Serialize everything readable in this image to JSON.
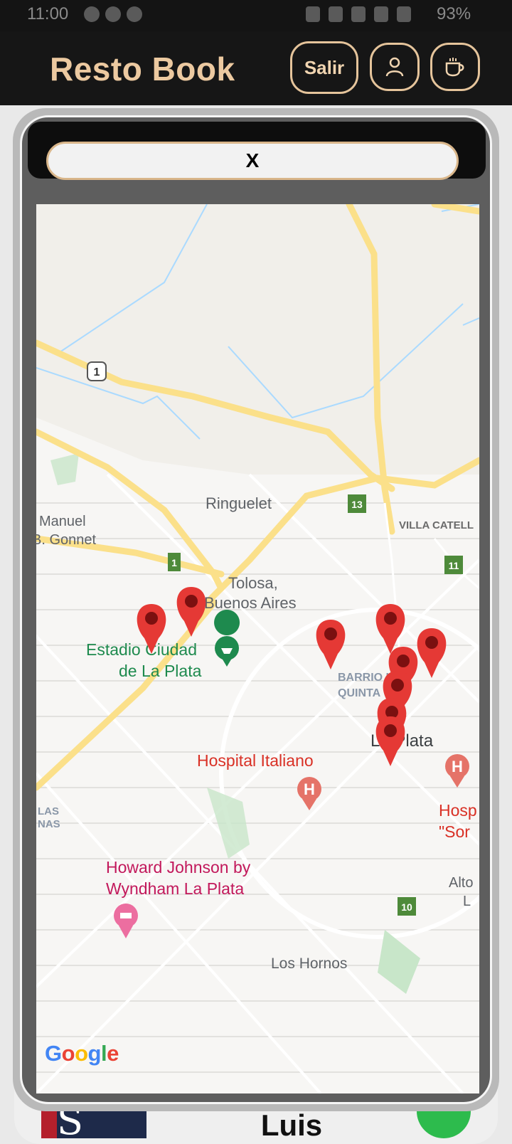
{
  "status_bar": {
    "time": "11:00",
    "battery": "93%"
  },
  "header": {
    "title": "Resto Book",
    "exit_label": "Salir"
  },
  "modal": {
    "close_label": "X"
  },
  "map": {
    "labels": {
      "ringuelet": "Ringuelet",
      "manuel_gonnet_1": "Manuel",
      "manuel_gonnet_2": "B. Gonnet",
      "villa_elisa": "VILLA CATELL",
      "tolosa_1": "Tolosa,",
      "tolosa_2": "Buenos Aires",
      "estadio_1": "Estadio Ciudad",
      "estadio_2": "de La Plata",
      "barrio_1": "BARRIO LA",
      "barrio_2": "QUINTA",
      "la_plata": "La Plata",
      "hospital_italiano": "Hospital Italiano",
      "hosp_1": "Hosp",
      "hosp_2": "\"Sor",
      "howard_1": "Howard Johnson by",
      "howard_2": "Wyndham La Plata",
      "las_1": "LAS",
      "las_2": "NAS",
      "alto_1": "Alto",
      "alto_2": "L",
      "los_hornos": "Los Hornos"
    },
    "route_shields": [
      "1",
      "1",
      "13",
      "11",
      "10"
    ],
    "attribution": "Google"
  },
  "background": {
    "restaurant_name": "Cantina San Luis"
  },
  "colors": {
    "accent": "#e5c49b",
    "header_bg": "#161616",
    "marker": "#e53935"
  }
}
